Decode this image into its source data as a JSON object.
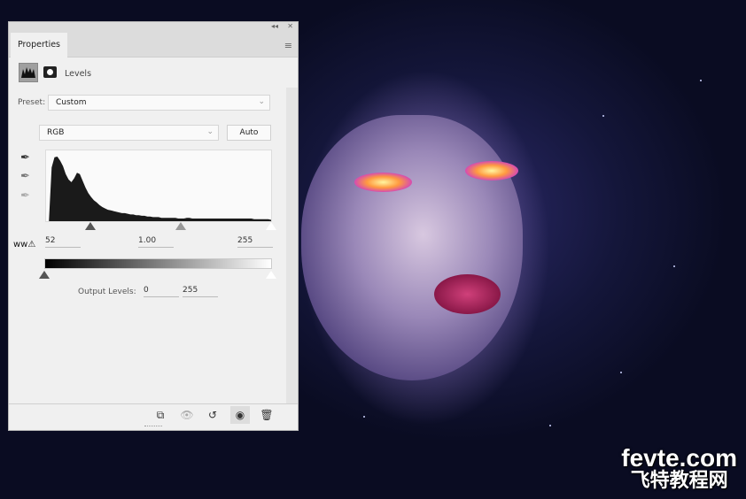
{
  "panel": {
    "tab": "Properties",
    "adjustment": "Levels",
    "preset_label": "Preset:",
    "preset_value": "Custom",
    "channel": "RGB",
    "auto_label": "Auto",
    "input_levels": {
      "black": "52",
      "gamma": "1.00",
      "white": "255"
    },
    "output_label": "Output Levels:",
    "output_levels": {
      "black": "0",
      "white": "255"
    },
    "histogram": [
      0,
      0,
      80,
      95,
      96,
      90,
      82,
      70,
      62,
      58,
      64,
      72,
      70,
      60,
      50,
      42,
      36,
      31,
      28,
      24,
      21,
      19,
      17,
      16,
      15,
      14,
      13,
      12,
      12,
      11,
      10,
      10,
      9,
      9,
      8,
      8,
      7,
      7,
      6,
      6,
      6,
      5,
      5,
      5,
      5,
      5,
      5,
      4,
      4,
      4,
      5,
      5,
      4,
      4,
      4,
      4,
      4,
      4,
      4,
      4,
      4,
      4,
      4,
      4,
      4,
      4,
      4,
      4,
      4,
      4,
      4,
      4,
      4,
      4,
      3,
      3,
      3,
      3,
      3,
      3,
      2
    ]
  },
  "watermark": {
    "line1": "fevte.com",
    "line2": "飞特教程网"
  }
}
